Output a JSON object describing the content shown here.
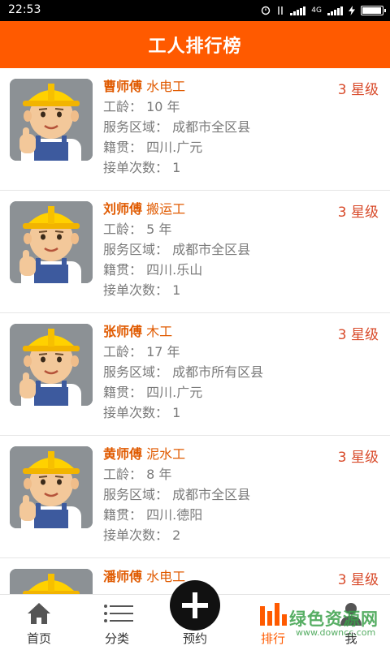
{
  "status": {
    "time": "22:53",
    "network": "4G"
  },
  "header": {
    "title": "工人排行榜"
  },
  "workers": [
    {
      "name": "曹师傅",
      "trade": "水电工",
      "rank": "3 星级",
      "age_label": "工龄：",
      "age": "10 年",
      "area_label": "服务区域：",
      "area": "成都市全区县",
      "origin_label": "籍贯：",
      "origin": "四川.广元",
      "orders_label": "接单次数：",
      "orders": "1"
    },
    {
      "name": "刘师傅",
      "trade": "搬运工",
      "rank": "3 星级",
      "age_label": "工龄：",
      "age": "5 年",
      "area_label": "服务区域：",
      "area": "成都市全区县",
      "origin_label": "籍贯：",
      "origin": "四川.乐山",
      "orders_label": "接单次数：",
      "orders": "1"
    },
    {
      "name": "张师傅",
      "trade": "木工",
      "rank": "3 星级",
      "age_label": "工龄：",
      "age": "17 年",
      "area_label": "服务区域：",
      "area": "成都市所有区县",
      "origin_label": "籍贯：",
      "origin": "四川.广元",
      "orders_label": "接单次数：",
      "orders": "1"
    },
    {
      "name": "黄师傅",
      "trade": "泥水工",
      "rank": "3 星级",
      "age_label": "工龄：",
      "age": "8 年",
      "area_label": "服务区域：",
      "area": "成都市全区县",
      "origin_label": "籍贯：",
      "origin": "四川.德阳",
      "orders_label": "接单次数：",
      "orders": "2"
    },
    {
      "name": "潘师傅",
      "trade": "水电工",
      "rank": "3 星级"
    }
  ],
  "tabs": [
    {
      "label": "首页",
      "icon": "home-icon"
    },
    {
      "label": "分类",
      "icon": "list-icon"
    },
    {
      "label": "预约",
      "icon": "plus-icon"
    },
    {
      "label": "排行",
      "icon": "bar-chart-icon",
      "active": true
    },
    {
      "label": "我",
      "icon": "user-icon"
    }
  ],
  "watermark": {
    "line1": "绿色资源网",
    "line2": "www.downcc.com"
  },
  "colors": {
    "accent": "#ff5a00",
    "rank": "#d84a2a",
    "text": "#7a7a7a"
  }
}
